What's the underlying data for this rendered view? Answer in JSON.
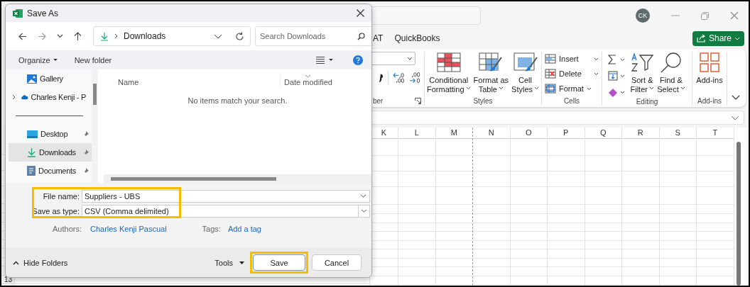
{
  "excel": {
    "avatar": "CK",
    "tabs": [
      {
        "label": "AT",
        "selected": false
      },
      {
        "label": "QuickBooks",
        "selected": false
      }
    ],
    "share": "Share",
    "ribbon": {
      "number": {
        "label": "ber"
      },
      "styles": {
        "label": "Styles",
        "buttons": [
          {
            "lines": [
              "Conditional",
              "Formatting"
            ]
          },
          {
            "lines": [
              "Format as",
              "Table"
            ]
          },
          {
            "lines": [
              "Cell",
              "Styles"
            ]
          }
        ]
      },
      "cells": {
        "label": "Cells",
        "buttons": [
          "Insert",
          "Delete",
          "Format"
        ]
      },
      "editing": {
        "label": "Editing",
        "buttons": [
          {
            "lines": [
              "Sort &",
              "Filter"
            ]
          },
          {
            "lines": [
              "Find &",
              "Select"
            ]
          }
        ]
      },
      "addins": {
        "label": "Add-ins",
        "buttons": [
          {
            "lines": [
              "Add-ins"
            ]
          }
        ]
      }
    },
    "columns": [
      "K",
      "L",
      "M",
      "N",
      "O",
      "P",
      "Q",
      "R",
      "S",
      "T"
    ],
    "row_number": "13"
  },
  "dialog": {
    "title": "Save As",
    "path": "Downloads",
    "search": {
      "placeholder": "Search Downloads"
    },
    "organize": "Organize",
    "new_folder": "New folder",
    "nav": [
      {
        "kind": "item",
        "label": "Gallery",
        "selected": false,
        "pinned": false,
        "expandable": false
      },
      {
        "kind": "item",
        "label": "Charles Kenji - P",
        "selected": false,
        "pinned": false,
        "expandable": true
      },
      {
        "kind": "divider"
      },
      {
        "kind": "item",
        "label": "Desktop",
        "selected": false,
        "pinned": true,
        "expandable": false
      },
      {
        "kind": "item",
        "label": "Downloads",
        "selected": true,
        "pinned": true,
        "expandable": false
      },
      {
        "kind": "item",
        "label": "Documents",
        "selected": false,
        "pinned": true,
        "expandable": false
      }
    ],
    "columns": [
      "Name",
      "Date modified"
    ],
    "empty_message": "No items match your search.",
    "fields_highlighted": true,
    "file_name": {
      "label": "File name:",
      "value": "Suppliers - UBS"
    },
    "save_as_type": {
      "label": "Save as type:",
      "value": "CSV (Comma delimited)"
    },
    "authors": {
      "label": "Authors:",
      "value": "Charles Kenji Pascual"
    },
    "tags": {
      "label": "Tags:",
      "value": "Add a tag"
    },
    "hide_folders": "Hide Folders",
    "tools": "Tools",
    "save": {
      "label": "Save",
      "highlighted": true
    },
    "cancel": "Cancel"
  }
}
